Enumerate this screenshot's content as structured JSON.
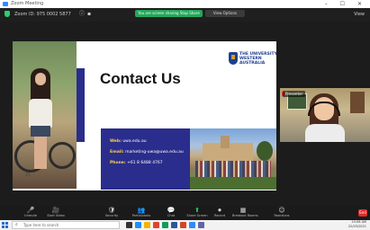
{
  "window": {
    "app_title": "Zoom Meeting",
    "controls": "–  ☐  ✕"
  },
  "meeting_bar": {
    "info_text": "Zoom ID: 975 0002 5877",
    "share_banner": "You are screen sharing Stop Share",
    "view_banner": "View Options",
    "view_label": "View",
    "accent_green": "#26a65b"
  },
  "slide": {
    "title": "Contact Us",
    "logo_text": "THE UNIVERSITY OF\nWESTERN\nAUSTRALIA",
    "slide_number": "21",
    "contact_rows": [
      {
        "label": "Web:",
        "value": "uwa.edu.au"
      },
      {
        "label": "Email:",
        "value": "marketing-uwa@uwa.edu.au"
      },
      {
        "label": "Phone:",
        "value": "+61 8 6488 4767"
      }
    ],
    "brand_navy": "#2a2d8c"
  },
  "participant": {
    "name": "Presenter"
  },
  "toolbar": {
    "items": [
      {
        "icon": "mic-icon",
        "glyph": "🎤",
        "label": "Unmute"
      },
      {
        "icon": "video-icon",
        "glyph": "🎥",
        "label": "Start Video"
      },
      {
        "icon": "shield-icon",
        "glyph": "🛡",
        "label": "Security"
      },
      {
        "icon": "participants-icon",
        "glyph": "👥",
        "label": "Participants"
      },
      {
        "icon": "chat-icon",
        "glyph": "💬",
        "label": "Chat"
      },
      {
        "icon": "share-icon",
        "glyph": "⬆",
        "label": "Share Screen"
      },
      {
        "icon": "record-icon",
        "glyph": "⏺",
        "label": "Record"
      },
      {
        "icon": "rooms-icon",
        "glyph": "▦",
        "label": "Breakout Rooms"
      },
      {
        "icon": "reactions-icon",
        "glyph": "☺",
        "label": "Reactions"
      }
    ],
    "end_label": "End"
  },
  "taskbar": {
    "search_placeholder": "Type here to search",
    "time": "10:08 AM",
    "date": "22/03/2021"
  }
}
